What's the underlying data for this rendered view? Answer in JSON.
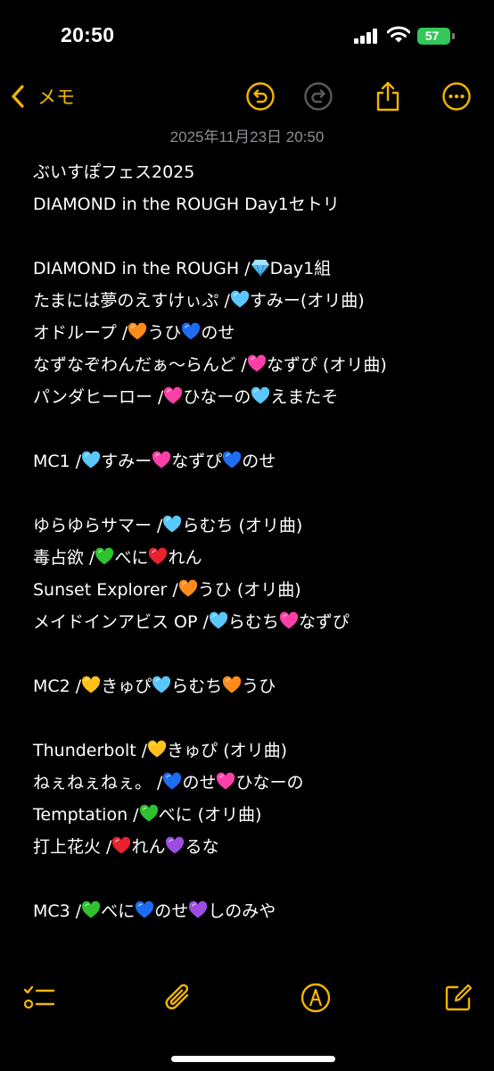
{
  "status_bar": {
    "time": "20:50",
    "battery_level": "57"
  },
  "nav": {
    "back_label": "メモ",
    "accent_color": "#f2b600"
  },
  "note": {
    "date": "2025年11月23日 20:50",
    "lines": [
      [
        {
          "t": "ぶいすぽフェス2025"
        }
      ],
      [
        {
          "t": "DIAMOND in the ROUGH Day1セトリ"
        }
      ],
      [],
      [
        {
          "t": "DIAMOND in the ROUGH /"
        },
        {
          "e": "gem"
        },
        {
          "t": "Day1組"
        }
      ],
      [
        {
          "t": "たまには夢のえすけぃぷ /"
        },
        {
          "e": "light-blue"
        },
        {
          "t": "すみー(オリ曲)"
        }
      ],
      [
        {
          "t": "オドループ /"
        },
        {
          "e": "orange"
        },
        {
          "t": "うひ"
        },
        {
          "e": "blue"
        },
        {
          "t": "のせ"
        }
      ],
      [
        {
          "t": "なずなぞわんだぁ〜らんど /"
        },
        {
          "e": "pink"
        },
        {
          "t": "なずぴ (オリ曲)"
        }
      ],
      [
        {
          "t": "パンダヒーロー /"
        },
        {
          "e": "pink"
        },
        {
          "t": "ひなーの"
        },
        {
          "e": "light-blue"
        },
        {
          "t": "えまたそ"
        }
      ],
      [],
      [
        {
          "t": "MC1  /"
        },
        {
          "e": "light-blue"
        },
        {
          "t": "すみー"
        },
        {
          "e": "pink"
        },
        {
          "t": "なずぴ"
        },
        {
          "e": "blue"
        },
        {
          "t": "のせ"
        }
      ],
      [],
      [
        {
          "t": "ゆらゆらサマー /"
        },
        {
          "e": "light-blue"
        },
        {
          "t": "らむち (オリ曲)"
        }
      ],
      [
        {
          "t": "毒占欲 /"
        },
        {
          "e": "green"
        },
        {
          "t": "べに"
        },
        {
          "e": "red"
        },
        {
          "t": "れん"
        }
      ],
      [
        {
          "t": "Sunset Explorer /"
        },
        {
          "e": "orange"
        },
        {
          "t": "うひ (オリ曲)"
        }
      ],
      [
        {
          "t": "メイドインアビス OP /"
        },
        {
          "e": "light-blue"
        },
        {
          "t": "らむち"
        },
        {
          "e": "pink"
        },
        {
          "t": "なずぴ"
        }
      ],
      [],
      [
        {
          "t": "MC2 /"
        },
        {
          "e": "yellow"
        },
        {
          "t": "きゅぴ"
        },
        {
          "e": "light-blue"
        },
        {
          "t": "らむち"
        },
        {
          "e": "orange"
        },
        {
          "t": "うひ"
        }
      ],
      [],
      [
        {
          "t": "Thunderbolt /"
        },
        {
          "e": "yellow"
        },
        {
          "t": "きゅぴ (オリ曲)"
        }
      ],
      [
        {
          "t": "ねぇねぇねぇ。 /"
        },
        {
          "e": "blue"
        },
        {
          "t": "のせ"
        },
        {
          "e": "pink"
        },
        {
          "t": "ひなーの"
        }
      ],
      [
        {
          "t": "Temptation /"
        },
        {
          "e": "green"
        },
        {
          "t": "べに (オリ曲)"
        }
      ],
      [
        {
          "t": "打上花火 /"
        },
        {
          "e": "red"
        },
        {
          "t": "れん"
        },
        {
          "e": "purple"
        },
        {
          "t": "るな"
        }
      ],
      [],
      [
        {
          "t": "MC3 /"
        },
        {
          "e": "green"
        },
        {
          "t": "べに"
        },
        {
          "e": "blue"
        },
        {
          "t": "のせ"
        },
        {
          "e": "purple"
        },
        {
          "t": "しのみや"
        }
      ]
    ]
  },
  "heart_colors": {
    "light-blue": "#5ac8fa",
    "blue": "#1e6cf0",
    "orange": "#ff8c1a",
    "pink": "#ff3fa8",
    "green": "#2fc12f",
    "red": "#e8222e",
    "yellow": "#ffc21a",
    "purple": "#9b4de0"
  },
  "icons": {
    "back": "chevron-left-icon",
    "undo": "undo-icon",
    "redo": "redo-icon",
    "share": "share-icon",
    "more": "more-icon",
    "checklist": "checklist-icon",
    "attach": "paperclip-icon",
    "markup": "markup-pen-icon",
    "compose": "compose-icon"
  }
}
